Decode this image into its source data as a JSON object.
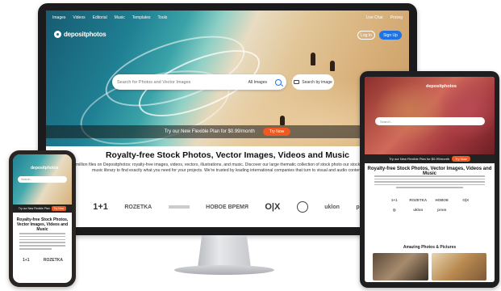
{
  "monitor": {
    "nav": [
      "Images",
      "Videos",
      "Editorial",
      "Music",
      "Templates",
      "Tools"
    ],
    "nav_right": [
      "Live Chat",
      "Pricing"
    ],
    "logo": "depositphotos",
    "login": "Log In",
    "signup": "Sign Up",
    "search_placeholder": "Search for Photos and Vector Images",
    "search_filter": "All Images",
    "image_search": "Search by image",
    "promo": "Try our New Flexible Plan for $0.99/month",
    "try_now": "Try Now",
    "heading": "Royalty-free Stock Photos, Vector Images, Videos and Music",
    "intro": "million files on Depositphotos: royalty-free images, videos, vectors, illustrations, and music. Discover our large thematic collection of stock photo our stock video and music library to find exactly what you need for your projects. We're trusted by leading international companies that turn to visual and audio content.",
    "client_logos": [
      "1+1",
      "ROZETKA",
      "",
      "НОВОЕ ВРЕМЯ",
      "O|X",
      "",
      "uklon",
      "pro"
    ]
  },
  "phone": {
    "logo": "depositphotos",
    "search": "Search...",
    "promo": "Try our New Flexible Plan",
    "promo_btn": "Try Now",
    "title": "Royalty-free Stock Photos, Vector Images, Videos and Music",
    "logos": [
      "1+1",
      "ROZETKA"
    ]
  },
  "tablet": {
    "logo": "depositphotos",
    "search": "Search...",
    "promo": "Try our New Flexible Plan for $0.99/month",
    "promo_btn": "Try Now",
    "title": "Royalty-free Stock Photos, Vector Images, Videos and Music",
    "logos": [
      "1+1",
      "ROZETKA",
      "НОВОЕ",
      "O|X",
      "",
      "uklon",
      "prom",
      ""
    ],
    "section": "Amazing Photos & Pictures"
  }
}
